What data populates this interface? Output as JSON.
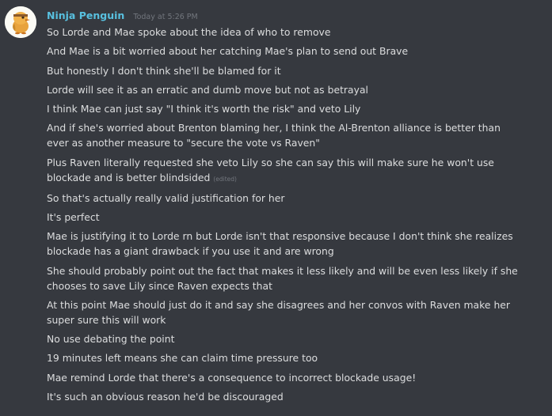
{
  "message": {
    "username": "Ninja Penguin",
    "timestamp": "Today at 5:26 PM",
    "edited_label": "(edited)",
    "lines": [
      [
        "So Lorde and Mae spoke about the idea of who to remove"
      ],
      [
        "And Mae is a bit worried about her catching Mae's plan to send out Brave"
      ],
      [
        "But honestly I don't think she'll be blamed for it"
      ],
      [
        "Lorde will see it as an erratic and dumb move but not as betrayal"
      ],
      [
        "I think Mae can just say \"I think it's worth the risk\" and veto Lily"
      ],
      [
        "And if she's worried about Brenton blaming her, I think the Al-Brenton alliance is better than",
        "ever as another measure to \"secure the vote vs Raven\""
      ],
      [
        "Plus Raven literally requested she veto Lily so she can say this will make sure he won't use",
        "blockade and is better blindsided"
      ],
      [
        "So that's actually really valid justification for her"
      ],
      [
        "It's perfect"
      ],
      [
        "Mae is justifying it to Lorde rn but Lorde isn't that responsive because I don't think she realizes",
        "blockade has a giant drawback if you use it and are wrong"
      ],
      [
        "She should probably point out the fact that makes it less likely and will be even less likely if she",
        "chooses to save Lily since Raven expects that"
      ],
      [
        "At this point Mae should just do it and say she disagrees and her convos with Raven make her",
        "super sure this will work"
      ],
      [
        "No use debating the point"
      ],
      [
        "19 minutes left means she can claim time pressure too"
      ],
      [
        "Mae remind Lorde that there's a consequence to incorrect blockade usage!"
      ],
      [
        "It's such an obvious reason he'd be discouraged"
      ]
    ],
    "edited_message_index": 6
  },
  "colors": {
    "background": "#36393f",
    "username": "#58c0df",
    "text": "#dcddde",
    "muted": "#72767d"
  },
  "icons": {
    "avatar": "penguin-avatar-icon"
  }
}
